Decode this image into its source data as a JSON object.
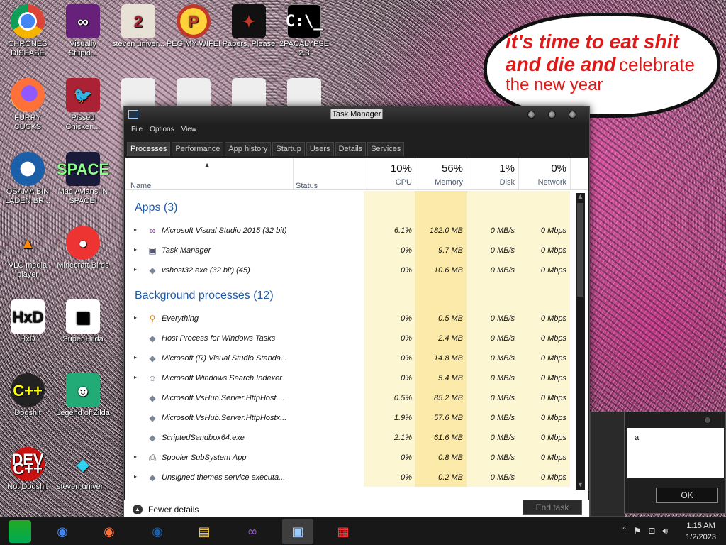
{
  "desktop": {
    "icons": [
      {
        "label": "CHRONES DISEASE",
        "glyph": ""
      },
      {
        "label": "Visually Stupid...",
        "glyph": "∞"
      },
      {
        "label": "steven univer...",
        "glyph": "2"
      },
      {
        "label": "PEG MY WIFE!",
        "glyph": "P"
      },
      {
        "label": "Papers, Please",
        "glyph": "✦"
      },
      {
        "label": "2PACALYPSE 2.3",
        "glyph": "C:\\_"
      },
      {
        "label": "FURRY CUCKS",
        "glyph": ""
      },
      {
        "label": "Pissed Chicken...",
        "glyph": "🐦"
      },
      {
        "label": "OSAMA BIN LADEN BR...",
        "glyph": ""
      },
      {
        "label": "Mad Avians IN SPACE!",
        "glyph": "SPACE"
      },
      {
        "label": "VLC media player",
        "glyph": "▲"
      },
      {
        "label": "Minecraft Birds",
        "glyph": "●"
      },
      {
        "label": "HxD",
        "glyph": "HxD"
      },
      {
        "label": "Super Hilda",
        "glyph": "▦"
      },
      {
        "label": "Dogshit",
        "glyph": "C++"
      },
      {
        "label": "Legend of Zilda",
        "glyph": "☻"
      },
      {
        "label": "Not Dogshit",
        "glyph": "DEV C++"
      },
      {
        "label": "steven univer...",
        "glyph": "◆"
      }
    ]
  },
  "bubble": {
    "line1": "it's time to eat shit",
    "line2a": "and die and",
    "line2b": "celebrate",
    "line3": "the new year"
  },
  "taskmanager": {
    "title": "Task Manager",
    "menu": [
      "File",
      "Options",
      "View"
    ],
    "tabs": [
      "Processes",
      "Performance",
      "App history",
      "Startup",
      "Users",
      "Details",
      "Services"
    ],
    "active_tab": "Processes",
    "columns": {
      "name": "Name",
      "status": "Status",
      "cpu": {
        "pct": "10%",
        "label": "CPU"
      },
      "memory": {
        "pct": "56%",
        "label": "Memory"
      },
      "disk": {
        "pct": "1%",
        "label": "Disk"
      },
      "network": {
        "pct": "0%",
        "label": "Network"
      }
    },
    "groups": {
      "apps": "Apps (3)",
      "background": "Background processes (12)"
    },
    "apps": [
      {
        "expand": "▸",
        "icon": "vs-icon",
        "name": "Microsoft Visual Studio 2015 (32 bit)",
        "cpu": "6.1%",
        "memory": "182.0 MB",
        "disk": "0 MB/s",
        "network": "0 Mbps"
      },
      {
        "expand": "▸",
        "icon": "task-manager-icon",
        "name": "Task Manager",
        "cpu": "0%",
        "memory": "9.7 MB",
        "disk": "0 MB/s",
        "network": "0 Mbps"
      },
      {
        "expand": "▸",
        "icon": "process-icon",
        "name": "vshost32.exe (32 bit) (45)",
        "cpu": "0%",
        "memory": "10.6 MB",
        "disk": "0 MB/s",
        "network": "0 Mbps"
      }
    ],
    "background": [
      {
        "expand": "▸",
        "icon": "search-icon",
        "name": "Everything",
        "cpu": "0%",
        "memory": "0.5 MB",
        "disk": "0 MB/s",
        "network": "0 Mbps"
      },
      {
        "expand": "",
        "icon": "process-icon",
        "name": "Host Process for Windows Tasks",
        "cpu": "0%",
        "memory": "2.4 MB",
        "disk": "0 MB/s",
        "network": "0 Mbps"
      },
      {
        "expand": "▸",
        "icon": "process-icon",
        "name": "Microsoft (R) Visual Studio Standa...",
        "cpu": "0%",
        "memory": "14.8 MB",
        "disk": "0 MB/s",
        "network": "0 Mbps"
      },
      {
        "expand": "▸",
        "icon": "user-search-icon",
        "name": "Microsoft Windows Search Indexer",
        "cpu": "0%",
        "memory": "5.4 MB",
        "disk": "0 MB/s",
        "network": "0 Mbps"
      },
      {
        "expand": "",
        "icon": "process-icon",
        "name": "Microsoft.VsHub.Server.HttpHost....",
        "cpu": "0.5%",
        "memory": "85.2 MB",
        "disk": "0 MB/s",
        "network": "0 Mbps"
      },
      {
        "expand": "",
        "icon": "process-icon",
        "name": "Microsoft.VsHub.Server.HttpHostx...",
        "cpu": "1.9%",
        "memory": "57.6 MB",
        "disk": "0 MB/s",
        "network": "0 Mbps"
      },
      {
        "expand": "",
        "icon": "process-icon",
        "name": "ScriptedSandbox64.exe",
        "cpu": "2.1%",
        "memory": "61.6 MB",
        "disk": "0 MB/s",
        "network": "0 Mbps"
      },
      {
        "expand": "▸",
        "icon": "printer-icon",
        "name": "Spooler SubSystem App",
        "cpu": "0%",
        "memory": "0.8 MB",
        "disk": "0 MB/s",
        "network": "0 Mbps"
      },
      {
        "expand": "▸",
        "icon": "process-icon",
        "name": "Unsigned themes service executa...",
        "cpu": "0%",
        "memory": "0.2 MB",
        "disk": "0 MB/s",
        "network": "0 Mbps"
      }
    ],
    "fewer_details": "Fewer details",
    "end_task": "End task"
  },
  "dialog": {
    "message": "a",
    "ok": "OK"
  },
  "taskbar": {
    "time": "1:15 AM",
    "date": "1/2/2023"
  },
  "colors": {
    "group_heading": "#1e5ba7",
    "heat_light": "#fdf6d3",
    "heat_medium": "#fbeaa9",
    "heat_strong": "#f8dd8b"
  }
}
